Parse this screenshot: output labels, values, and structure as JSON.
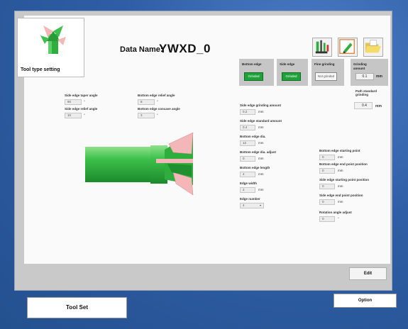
{
  "tool_type": {
    "label": "Tool type setting"
  },
  "data_name": {
    "label": "Data Name:",
    "value": "YWXD_0"
  },
  "top_icons": [
    "grinder-icon",
    "pencil-edit-icon",
    "folder-open-icon"
  ],
  "edge_headers": [
    {
      "title": "Bottom edge",
      "button": "Grinded",
      "state": "on"
    },
    {
      "title": "Side edge",
      "button": "Grinded",
      "state": "on"
    },
    {
      "title": "Fine grinding",
      "button": "Not grinded",
      "state": "off"
    }
  ],
  "grinding_amount": {
    "label": "Grinding amount",
    "value": "0.1",
    "unit": "mm"
  },
  "path_standard": {
    "label": "Path standard grinding",
    "value": "0.4",
    "unit": "mm"
  },
  "angles": {
    "side_taper": {
      "label": "Side edge taper angle",
      "value": "90",
      "unit": "°"
    },
    "side_relief": {
      "label": "Side edge relief angle",
      "value": "10",
      "unit": "°"
    },
    "bottom_relief": {
      "label": "Bottom edge relief angle",
      "value": "8",
      "unit": "°"
    },
    "bottom_concave": {
      "label": "Bottom edge concave angle",
      "value": "3",
      "unit": "°"
    }
  },
  "mid_fields": [
    {
      "label": "Side edge grinding amount",
      "value": "0.2",
      "unit": "mm"
    },
    {
      "label": "Side edge standard amount",
      "value": "0.4",
      "unit": "mm"
    },
    {
      "label": "Bottom edge dia.",
      "value": "12",
      "unit": "mm"
    },
    {
      "label": "Bottom edge dia. adjust",
      "value": "0",
      "unit": "mm"
    },
    {
      "label": "Bottom edge length",
      "value": "4",
      "unit": "mm"
    },
    {
      "label": "Edge width",
      "value": "2",
      "unit": "mm"
    }
  ],
  "edge_number": {
    "label": "Edge number",
    "value": "4"
  },
  "right_fields": [
    {
      "label": "Bottom edge starting point",
      "value": "0",
      "unit": "mm"
    },
    {
      "label": "Bottom edge end point position",
      "value": "0",
      "unit": "mm"
    },
    {
      "label": "Side edge starting point position",
      "value": "0",
      "unit": "mm"
    },
    {
      "label": "Side edge end point position",
      "value": "0",
      "unit": "mm"
    },
    {
      "label": "Rotation angle adjust",
      "value": "0",
      "unit": "°"
    }
  ],
  "buttons": {
    "edit": "Edit",
    "tool_set": "Tool Set",
    "option": "Option"
  },
  "colors": {
    "accent_green": "#1fa23a",
    "background_blue": "#2d5aa0",
    "tool_pink": "#f3b7b7"
  }
}
